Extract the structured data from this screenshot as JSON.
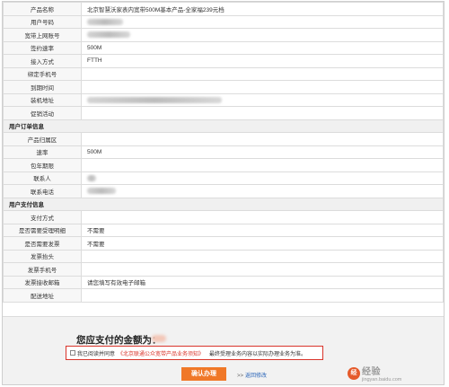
{
  "product": {
    "rows": [
      {
        "label": "产品名称",
        "value": "北京智慧沃家表内宽带500M基本产品-全家福239元档",
        "blurred": false
      },
      {
        "label": "用户号码",
        "value": "",
        "blurred": true,
        "blur_w": 40
      },
      {
        "label": "宽带上网账号",
        "value": "",
        "blurred": true,
        "blur_w": 48
      },
      {
        "label": "签约速率",
        "value": "500M",
        "blurred": false
      },
      {
        "label": "接入方式",
        "value": "FTTH",
        "blurred": false
      },
      {
        "label": "绑定手机号",
        "value": "",
        "blurred": false
      },
      {
        "label": "到期时间",
        "value": "",
        "blurred": false
      },
      {
        "label": "装机地址",
        "value": "",
        "blurred": true,
        "blur_w": 150
      },
      {
        "label": "促销活动",
        "value": "",
        "blurred": false
      }
    ]
  },
  "order": {
    "section_title": "用户订单信息",
    "rows": [
      {
        "label": "产品归属区",
        "value": "",
        "blurred": false
      },
      {
        "label": "速率",
        "value": "500M",
        "blurred": false
      },
      {
        "label": "包年期限",
        "value": "",
        "blurred": false
      },
      {
        "label": "联系人",
        "value": "",
        "blurred": true,
        "blur_w": 10
      },
      {
        "label": "联系电话",
        "value": "",
        "blurred": true,
        "blur_w": 32
      }
    ]
  },
  "payment": {
    "section_title": "用户支付信息",
    "rows": [
      {
        "label": "支付方式",
        "value": "",
        "blurred": false
      },
      {
        "label": "是否需要受理明细",
        "value": "不需要",
        "blurred": false
      },
      {
        "label": "是否需要发票",
        "value": "不需要",
        "blurred": false
      },
      {
        "label": "发票抬头",
        "value": "",
        "blurred": false
      },
      {
        "label": "发票手机号",
        "value": "",
        "blurred": false
      },
      {
        "label": "发票接收邮箱",
        "value": "请您填写有效电子邮箱",
        "blurred": false
      },
      {
        "label": "配送地址",
        "value": "",
        "blurred": false
      }
    ]
  },
  "footer": {
    "amount_label": "您应支付的金额为：",
    "agree_prefix": "我已阅读并同意",
    "agree_link": "《北京联通公众宽带产品业务须知》",
    "agree_note": "最终受理业务内容以实际办理业务为准。",
    "confirm_label": "确认办理",
    "back_arrow": ">>",
    "back_label": "返回修改"
  },
  "watermark": {
    "icon_glyph": "经",
    "text_cn": "经验",
    "text_en": "jingyan.baidu.com"
  },
  "colors": {
    "accent_red": "#d9342b",
    "button_orange": "#f07828",
    "link_blue": "#2b65b8"
  }
}
